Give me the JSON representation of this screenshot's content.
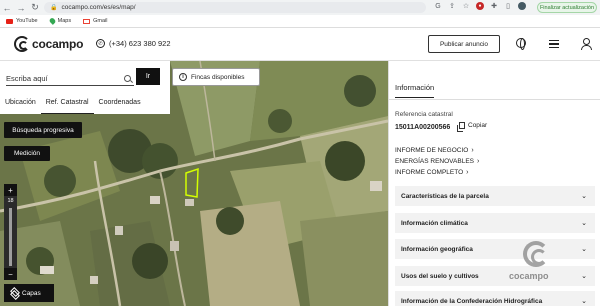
{
  "browser": {
    "url": "cocampo.com/es/es/map/",
    "update_label": "Finalizar actualización",
    "bookmarks": [
      {
        "label": "YouTube",
        "icon": "youtube-icon"
      },
      {
        "label": "Maps",
        "icon": "maps-icon"
      },
      {
        "label": "Gmail",
        "icon": "gmail-icon"
      }
    ]
  },
  "header": {
    "logo_text": "cocampo",
    "phone": "(+34) 623 380 922",
    "publish_label": "Publicar anuncio"
  },
  "search": {
    "placeholder": "Escriba aquí",
    "go_label": "Ir",
    "tabs": [
      {
        "label": "Ubicación",
        "active": false
      },
      {
        "label": "Ref. Catastral",
        "active": true
      },
      {
        "label": "Coordenadas",
        "active": false
      }
    ]
  },
  "map": {
    "fincas_label": "Fincas disponibles",
    "busqueda_label": "Búsqueda progresiva",
    "medicion_label": "Medición",
    "zoom_level": "18",
    "capas_label": "Capas",
    "parcel_color": "#d4ff00"
  },
  "info": {
    "tab_label": "Información",
    "ref_label": "Referencia catastral",
    "ref_value": "15011A00200566",
    "copy_label": "Copiar",
    "links": [
      "INFORME DE NEGOCIO",
      "ENERGÍAS RENOVABLES",
      "INFORME COMPLETO"
    ],
    "sections": [
      "Características de la parcela",
      "Información climática",
      "Información geográfica",
      "Usos del suelo y cultivos",
      "Información de la Confederación Hidrográfica"
    ],
    "watermark": "cocampo"
  }
}
